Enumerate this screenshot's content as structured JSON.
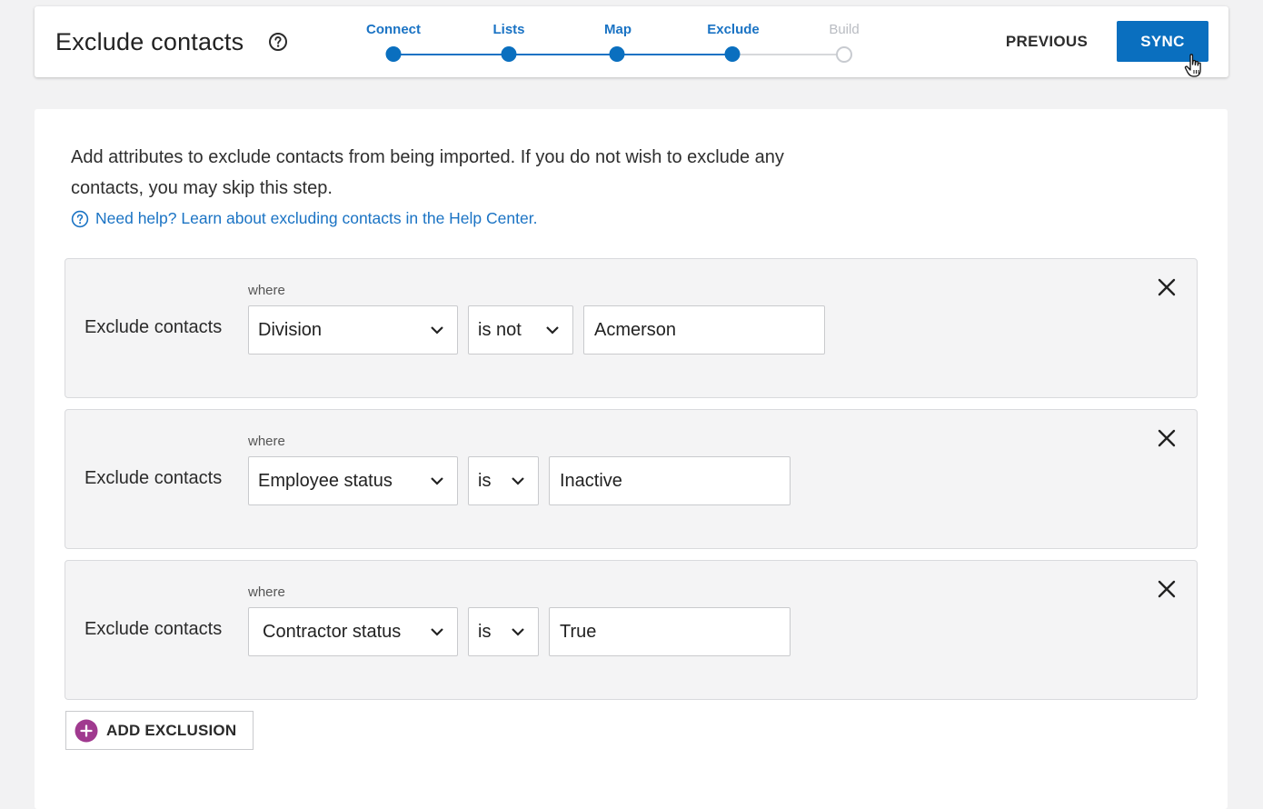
{
  "header": {
    "title": "Exclude contacts",
    "steps": [
      {
        "label": "Connect",
        "state": "complete"
      },
      {
        "label": "Lists",
        "state": "complete"
      },
      {
        "label": "Map",
        "state": "complete"
      },
      {
        "label": "Exclude",
        "state": "current"
      },
      {
        "label": "Build",
        "state": "upcoming"
      }
    ],
    "previous_label": "PREVIOUS",
    "sync_label": "SYNC"
  },
  "colors": {
    "accent": "#0a6fbf",
    "link": "#1a73c4",
    "add_icon": "#a03a8f"
  },
  "intro": {
    "text": "Add attributes to exclude contacts from being imported. If you do not wish to exclude any contacts, you may skip this step.",
    "help_link": "Need help? Learn about excluding contacts in the Help Center."
  },
  "rules": [
    {
      "label": "Exclude contacts",
      "where": "where",
      "attribute": "Division",
      "operator": "is not",
      "value": "Acmerson"
    },
    {
      "label": "Exclude contacts",
      "where": "where",
      "attribute": "Employee status",
      "operator": "is",
      "value": "Inactive"
    },
    {
      "label": "Exclude contacts",
      "where": "where",
      "attribute": "Contractor status",
      "operator": "is",
      "value": "True"
    }
  ],
  "add_exclusion_label": "ADD EXCLUSION"
}
